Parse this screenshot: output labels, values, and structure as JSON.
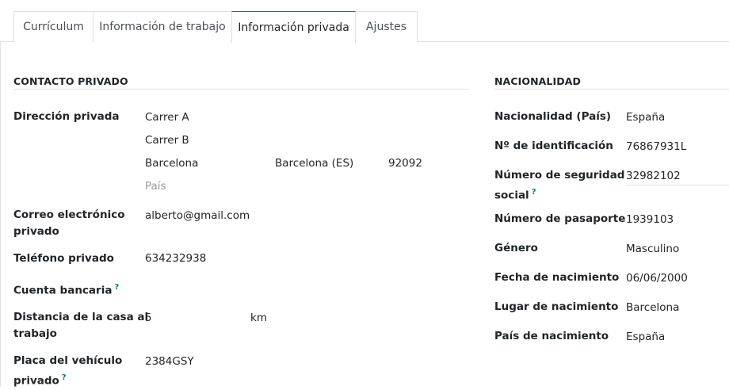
{
  "tabs": [
    {
      "label": "Currículum"
    },
    {
      "label": "Información de trabajo"
    },
    {
      "label": "Información privada"
    },
    {
      "label": "Ajustes"
    }
  ],
  "private_contact": {
    "title": "CONTACTO PRIVADO",
    "address_label": "Dirección privada",
    "street": "Carrer A",
    "street2": "Carrer B",
    "city": "Barcelona",
    "state": "Barcelona (ES)",
    "zip": "92092",
    "country_placeholder": "País",
    "email_label_1": "Correo electrónico",
    "email_label_2": "privado",
    "email": "alberto@gmail.com",
    "phone_label": "Teléfono privado",
    "phone": "634232938",
    "bank_label": "Cuenta bancaria",
    "bank_help": "?",
    "distance_label_1": "Distancia de la casa al",
    "distance_label_2": "trabajo",
    "distance": "5",
    "distance_unit": "km",
    "plate_label_1": "Placa del vehículo",
    "plate_label_2": "privado",
    "plate_help": "?",
    "plate": "2384GSY"
  },
  "nationality": {
    "title": "NACIONALIDAD",
    "country_label": "Nacionalidad (País)",
    "country": "España",
    "id_label": "Nº de identificación",
    "id": "76867931L",
    "ssn_label_1": "Número de seguridad",
    "ssn_label_2": "social",
    "ssn_help": "?",
    "ssn": "32982102",
    "passport_label": "Número de pasaporte",
    "passport": "1939103",
    "gender_label": "Género",
    "gender": "Masculino",
    "birthday_label": "Fecha de nacimiento",
    "birthday": "06/06/2000",
    "birthplace_label": "Lugar de nacimiento",
    "birthplace": "Barcelona",
    "birth_country_label": "País de nacimiento",
    "birth_country": "España"
  },
  "colors": {
    "active_tab_border": "#714b67",
    "help_icon": "#017e84",
    "border": "#dee2e6"
  }
}
